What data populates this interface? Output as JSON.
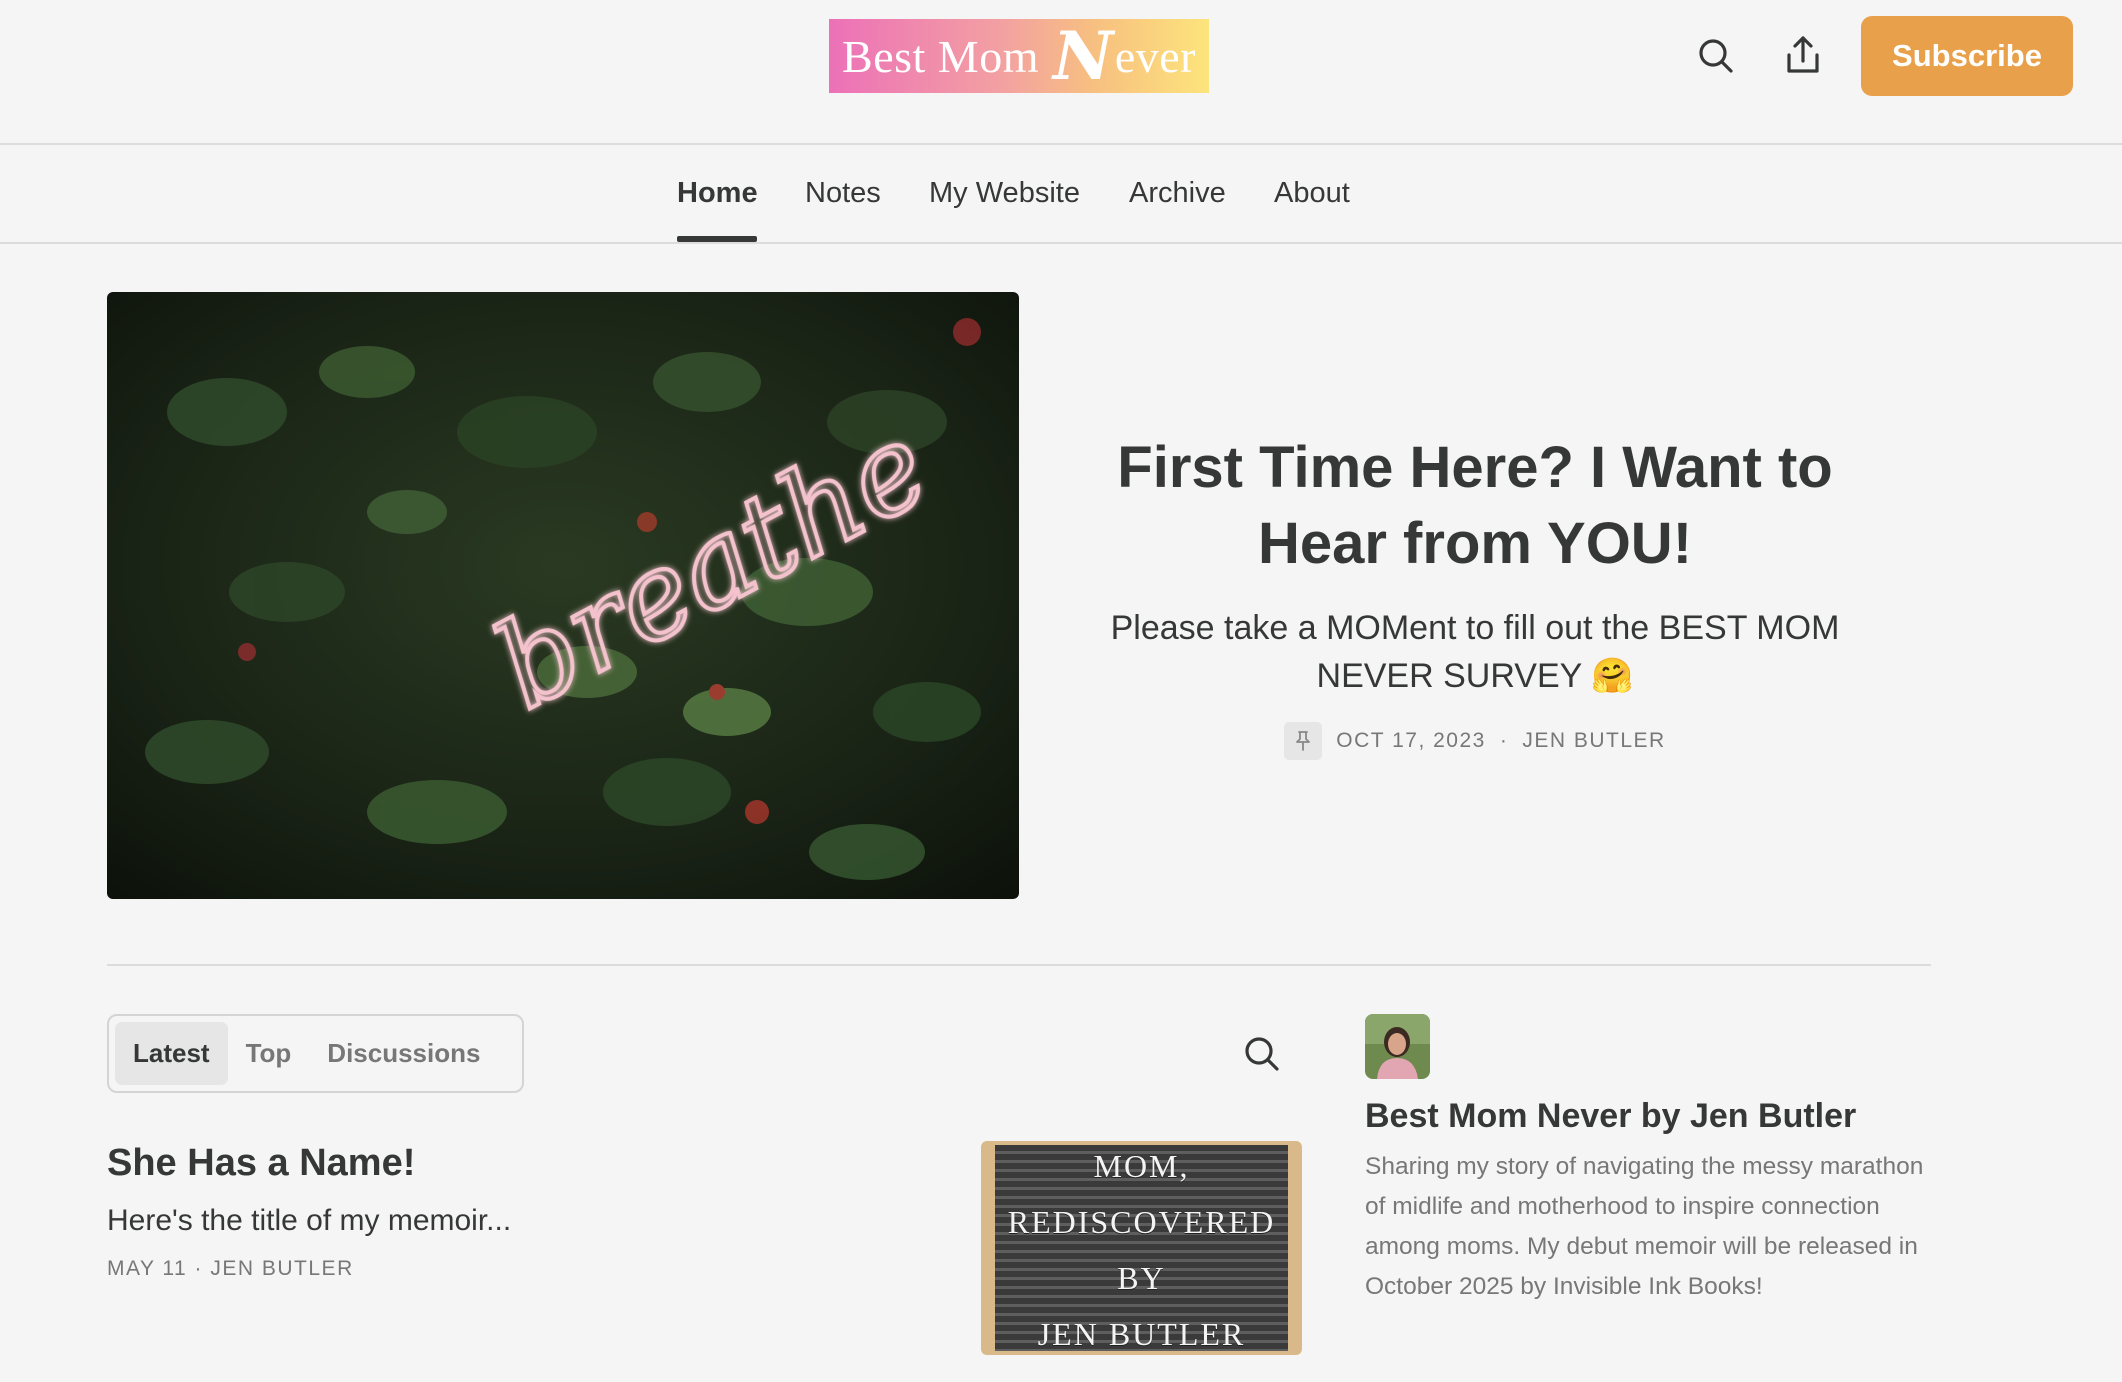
{
  "header": {
    "logo": {
      "text_before": "Best Mom ",
      "accent_letter": "N",
      "text_after": "ever"
    },
    "subscribe_label": "Subscribe",
    "icons": [
      "search-icon",
      "share-icon"
    ],
    "accent_color": "#e8a14a"
  },
  "nav": {
    "items": [
      {
        "label": "Home",
        "active": true
      },
      {
        "label": "Notes",
        "active": false
      },
      {
        "label": "My Website",
        "active": false
      },
      {
        "label": "Archive",
        "active": false
      },
      {
        "label": "About",
        "active": false
      }
    ]
  },
  "featured": {
    "image_text": "breathe",
    "title": "First Time Here? I Want to Hear from YOU!",
    "subtitle": "Please take a MOMent to fill out the BEST MOM NEVER SURVEY 🤗",
    "date": "OCT 17, 2023",
    "author": "JEN BUTLER",
    "pinned_icon": "pin-icon"
  },
  "feed": {
    "tabs": [
      {
        "label": "Latest",
        "active": true
      },
      {
        "label": "Top",
        "active": false
      },
      {
        "label": "Discussions",
        "active": false
      }
    ],
    "posts": [
      {
        "title": "She Has a Name!",
        "subtitle": "Here's the title of my memoir...",
        "date": "MAY 11",
        "author": "JEN BUTLER",
        "thumbnail_lines": [
          "MOM,",
          "REDISCOVERED",
          "BY",
          "JEN BUTLER"
        ]
      }
    ]
  },
  "sidebar": {
    "publication_name": "Best Mom Never by Jen Butler",
    "description": "Sharing my story of navigating the messy marathon of midlife and motherhood to inspire connection among moms. My debut memoir will be released in October 2025 by Invisible Ink Books!"
  }
}
